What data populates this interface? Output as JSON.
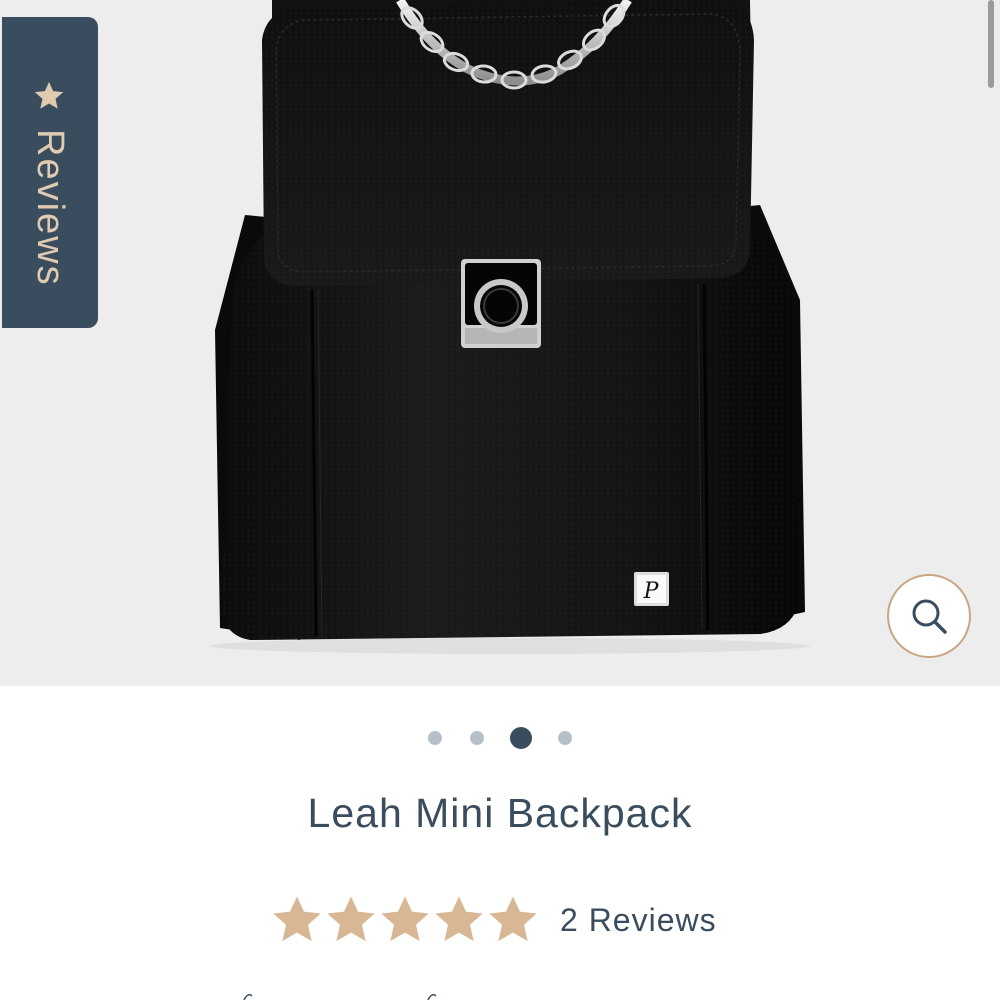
{
  "gallery": {
    "image_alt": "Leah Mini Backpack",
    "background_color": "#ededed",
    "slide_count": 4,
    "active_slide": 3
  },
  "reviews_tab": {
    "label": "Reviews",
    "icon": "star-icon",
    "background_color": "#3a4d5e",
    "text_color": "#e0cab0"
  },
  "zoom_button": {
    "icon": "magnifier-icon",
    "border_color": "#c9a784"
  },
  "product": {
    "title": "Leah Mini Backpack",
    "rating": 5,
    "rating_max": 5,
    "review_count_label": "2 Reviews",
    "star_color": "#d8b894",
    "text_color": "#3a4d5e"
  }
}
